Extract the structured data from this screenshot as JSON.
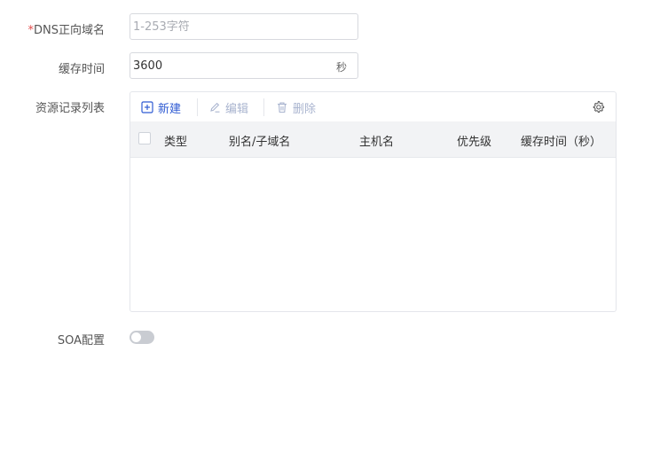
{
  "form": {
    "dns_name": {
      "required_mark": "*",
      "label": "DNS正向域名",
      "placeholder": "1-253字符",
      "value": ""
    },
    "ttl": {
      "label": "缓存时间",
      "value": "3600",
      "unit": "秒"
    },
    "records": {
      "label": "资源记录列表",
      "toolbar": {
        "new_label": "新建",
        "edit_label": "编辑",
        "delete_label": "删除"
      },
      "columns": [
        "类型",
        "别名/子域名",
        "主机名",
        "优先级",
        "缓存时间（秒）"
      ],
      "rows": []
    },
    "soa": {
      "label": "SOA配置",
      "enabled": false
    }
  },
  "colors": {
    "accent": "#2f5bd3",
    "disabled": "#a9b4cf",
    "required": "#e34d4d",
    "header_bg": "#f2f3f5"
  },
  "icons": {
    "new": "plus-square-icon",
    "edit": "pencil-icon",
    "delete": "trash-icon",
    "settings": "gear-icon"
  }
}
